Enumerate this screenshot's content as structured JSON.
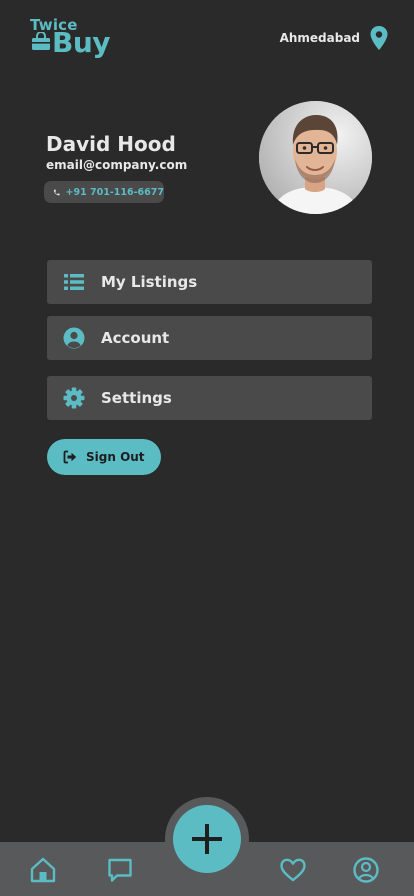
{
  "app": {
    "logo_top": "Twice",
    "logo_bottom": "Buy",
    "accent_color": "#5cbcc4",
    "background_color": "#2a2a2a"
  },
  "header": {
    "location": "Ahmedabad",
    "location_icon": "map-pin-icon"
  },
  "profile": {
    "name": "David Hood",
    "email": "email@company.com",
    "phone": "+91 701-116-6677",
    "phone_icon": "phone-icon",
    "avatar": "user-photo"
  },
  "menu": {
    "items": [
      {
        "label": "My Listings",
        "icon": "list-icon"
      },
      {
        "label": "Account",
        "icon": "user-circle-icon"
      },
      {
        "label": "Settings",
        "icon": "gear-icon"
      }
    ]
  },
  "sign_out": {
    "label": "Sign Out",
    "icon": "sign-out-icon"
  },
  "bottom_nav": {
    "items": [
      {
        "icon": "home-icon",
        "active": true
      },
      {
        "icon": "chat-icon",
        "active": false
      },
      {
        "icon": "heart-icon",
        "active": false
      },
      {
        "icon": "profile-icon",
        "active": false
      }
    ],
    "fab_icon": "plus-icon"
  }
}
